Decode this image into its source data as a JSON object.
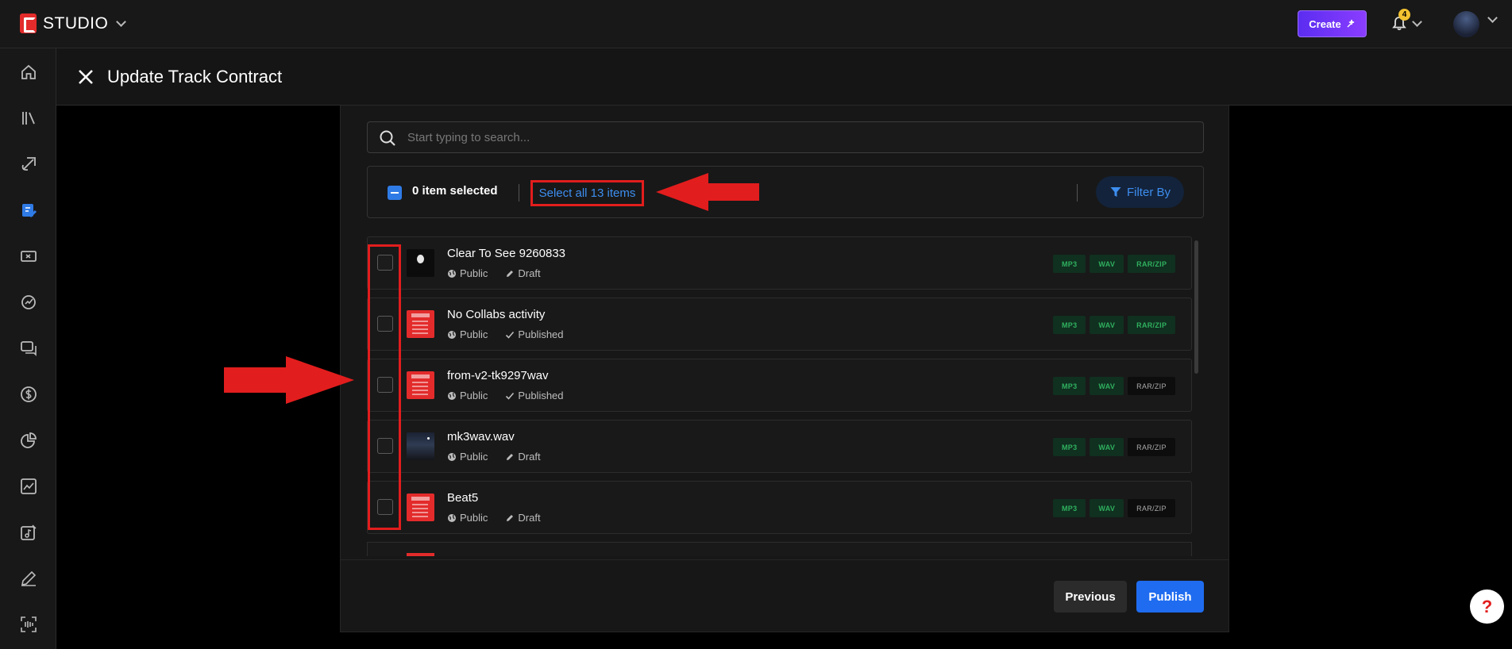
{
  "app": {
    "brand": "STUDIO",
    "create_label": "Create",
    "notification_count": "4"
  },
  "sidebar": {
    "icons": [
      "home-icon",
      "library-icon",
      "upload-icon",
      "contract-icon",
      "ticket-icon",
      "stats-icon",
      "messages-icon",
      "dollar-icon",
      "pie-chart-icon",
      "trend-icon",
      "music-edit-icon",
      "pen-icon",
      "scan-icon"
    ],
    "active": "contract-icon"
  },
  "header": {
    "title": "Update Track Contract"
  },
  "search": {
    "placeholder": "Start typing to search...",
    "value": ""
  },
  "selection": {
    "count_label": "0 item selected",
    "select_all_label": "Select all 13 items",
    "filter_label": "Filter By"
  },
  "tracks": [
    {
      "title": "Clear To See 9260833",
      "visibility": "Public",
      "status": "Draft",
      "status_icon": "pencil-icon",
      "thumb": "dark",
      "tags": [
        {
          "label": "MP3",
          "active": true
        },
        {
          "label": "WAV",
          "active": true
        },
        {
          "label": "RAR/ZIP",
          "active": true
        }
      ]
    },
    {
      "title": "No Collabs activity",
      "visibility": "Public",
      "status": "Published",
      "status_icon": "check-icon",
      "thumb": "red",
      "tags": [
        {
          "label": "MP3",
          "active": true
        },
        {
          "label": "WAV",
          "active": true
        },
        {
          "label": "RAR/ZIP",
          "active": true
        }
      ]
    },
    {
      "title": "from-v2-tk9297wav",
      "visibility": "Public",
      "status": "Published",
      "status_icon": "check-icon",
      "thumb": "red",
      "tags": [
        {
          "label": "MP3",
          "active": true
        },
        {
          "label": "WAV",
          "active": true
        },
        {
          "label": "RAR/ZIP",
          "active": false
        }
      ]
    },
    {
      "title": "mk3wav.wav",
      "visibility": "Public",
      "status": "Draft",
      "status_icon": "pencil-icon",
      "thumb": "night",
      "tags": [
        {
          "label": "MP3",
          "active": true
        },
        {
          "label": "WAV",
          "active": true
        },
        {
          "label": "RAR/ZIP",
          "active": false
        }
      ]
    },
    {
      "title": "Beat5",
      "visibility": "Public",
      "status": "Draft",
      "status_icon": "pencil-icon",
      "thumb": "red",
      "tags": [
        {
          "label": "MP3",
          "active": true
        },
        {
          "label": "WAV",
          "active": true
        },
        {
          "label": "RAR/ZIP",
          "active": false
        }
      ]
    }
  ],
  "footer": {
    "previous_label": "Previous",
    "publish_label": "Publish"
  },
  "help": {
    "label": "?"
  },
  "colors": {
    "accent": "#1f6cf0",
    "brand": "#e32b2b",
    "annotation": "#e21d1d",
    "tag_active": "#2fb05e"
  }
}
